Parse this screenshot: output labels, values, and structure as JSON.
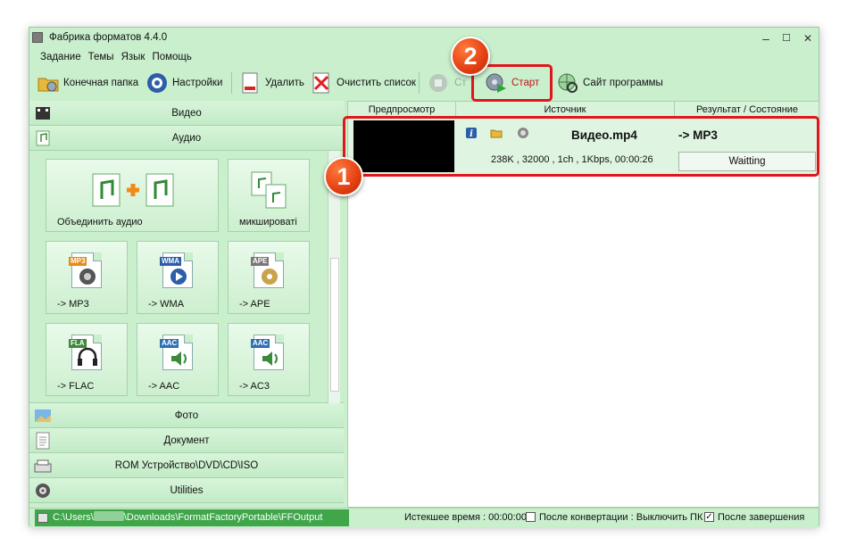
{
  "window": {
    "title": "Фабрика форматов 4.4.0",
    "controls": {
      "minimize": "–",
      "maximize": "☐",
      "close": "✕"
    }
  },
  "menu": [
    "Задание",
    "Темы",
    "Язык",
    "Помощь"
  ],
  "toolbar": {
    "output_folder": "Конечная папка",
    "settings": "Настройки",
    "delete": "Удалить",
    "clear_list": "Очистить список",
    "stop": "Ст",
    "start": "Старт",
    "website": "Сайт программы"
  },
  "categories": {
    "video": "Видео",
    "audio": "Аудио",
    "photo": "Фото",
    "document": "Документ",
    "rom": "ROM Устройство\\DVD\\CD\\ISO",
    "utilities": "Utilities"
  },
  "audio_tiles": [
    {
      "label": "Объединить аудио",
      "icon": "merge-audio-icon"
    },
    {
      "label": "микшироваті",
      "icon": "mix-audio-icon"
    },
    {
      "label": "-> MP3",
      "tag": "MP3",
      "tag_color": "#e8891a",
      "icon": "speaker-icon"
    },
    {
      "label": "-> WMA",
      "tag": "WMA",
      "tag_color": "#2d5ea8",
      "icon": "play-disc-icon"
    },
    {
      "label": "-> APE",
      "tag": "APE",
      "tag_color": "#777777",
      "icon": "cd-icon"
    },
    {
      "label": "-> FLAC",
      "tag": "FLA",
      "tag_color": "#3a8a3a",
      "icon": "headphones-icon"
    },
    {
      "label": "-> AAC",
      "tag": "AAC",
      "tag_color": "#2f6fb5",
      "icon": "music-icon"
    },
    {
      "label": "-> AC3",
      "tag": "AAC",
      "tag_color": "#2f6fb5",
      "icon": "music-icon"
    }
  ],
  "table": {
    "headers": [
      "Предпросмотр",
      "Источник",
      "Результат / Состояние"
    ],
    "rows": [
      {
        "source_name": "Видео.mp4",
        "source_info": "238K , 32000 , 1ch , 1Kbps, 00:00:26",
        "result_format": "-> MP3",
        "status": "Waitting"
      }
    ]
  },
  "statusbar": {
    "path_prefix": "C:\\Users\\",
    "path_suffix": "\\Downloads\\FormatFactoryPortable\\FFOutput",
    "elapsed": "Истекшее время : 00:00:00",
    "after_conversion": "После конвертации : Выключить ПК",
    "after_finish": "После завершения"
  },
  "annotations": {
    "badge1": "1",
    "badge2": "2"
  },
  "colors": {
    "window_bg": "#c9efcd",
    "accent_green": "#3fa64a",
    "callout_red": "#e0161c",
    "badge_orange": "#e33f12"
  }
}
